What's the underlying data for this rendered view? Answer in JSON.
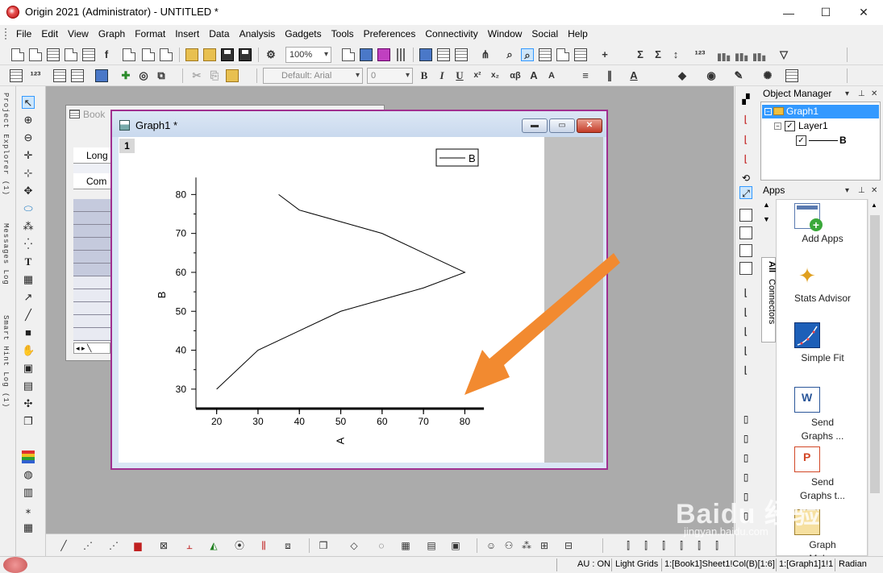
{
  "window": {
    "title": "Origin 2021 (Administrator) - UNTITLED *",
    "minimize": "—",
    "maximize": "☐",
    "close": "✕"
  },
  "menu": [
    "File",
    "Edit",
    "View",
    "Graph",
    "Format",
    "Insert",
    "Data",
    "Analysis",
    "Gadgets",
    "Tools",
    "Preferences",
    "Connectivity",
    "Window",
    "Social",
    "Help"
  ],
  "toolbar": {
    "zoom": "100%",
    "font_name": "Default: Arial",
    "font_size": "0",
    "bold": "B",
    "italic": "I",
    "underline": "U",
    "superscript": "x²",
    "subscript": "x₂",
    "greek": "αβ",
    "increase_font": "A",
    "decrease_font": "A"
  },
  "left_panel": {
    "project_explorer": "Project Explorer (1)",
    "messages_log": "Messages Log",
    "smart_hint_log": "Smart Hint Log (1)"
  },
  "book": {
    "title": "Book",
    "row_long_name": "Long",
    "row_comments": "Com"
  },
  "graph_window": {
    "title": "Graph1 *",
    "layer_number": "1"
  },
  "chart_data": {
    "type": "line",
    "x": [
      20,
      30,
      40,
      50,
      60,
      70,
      80,
      70,
      60,
      50,
      40,
      35
    ],
    "series": [
      {
        "name": "B",
        "values": [
          30,
          40,
          45,
          50,
          53,
          56,
          60,
          65,
          70,
          73,
          76,
          80
        ]
      }
    ],
    "xlabel": "A",
    "ylabel": "B",
    "xlim": [
      15,
      85
    ],
    "ylim": [
      25,
      85
    ],
    "xticks": [
      20,
      30,
      40,
      50,
      60,
      70,
      80
    ],
    "yticks": [
      30,
      40,
      50,
      60,
      70,
      80
    ],
    "grid": false,
    "legend": "top-right",
    "line_color": "#000000"
  },
  "object_manager": {
    "title": "Object Manager",
    "graph": "Graph1",
    "layer": "Layer1",
    "plot": "B"
  },
  "apps_panel": {
    "title": "Apps",
    "tab_all": "All",
    "tab_connectors": "Connectors",
    "items": [
      {
        "label": "Add Apps"
      },
      {
        "label": "Stats Advisor"
      },
      {
        "label": "Simple Fit"
      },
      {
        "label": "Send Graphs ..."
      },
      {
        "label": "Send Graphs t..."
      },
      {
        "label": "Graph Maker"
      }
    ]
  },
  "status_bar": {
    "au": "AU : ON",
    "theme": "Light Grids",
    "active_data": "1:[Book1]Sheet1!Col(B)[1:6]",
    "active_graph": "1:[Graph1]1!1",
    "angle": "Radian"
  },
  "watermark": {
    "text": "Baidu 经验",
    "url": "jingyan.baidu.com"
  },
  "annotation": {
    "arrow_color": "#f28a30"
  }
}
